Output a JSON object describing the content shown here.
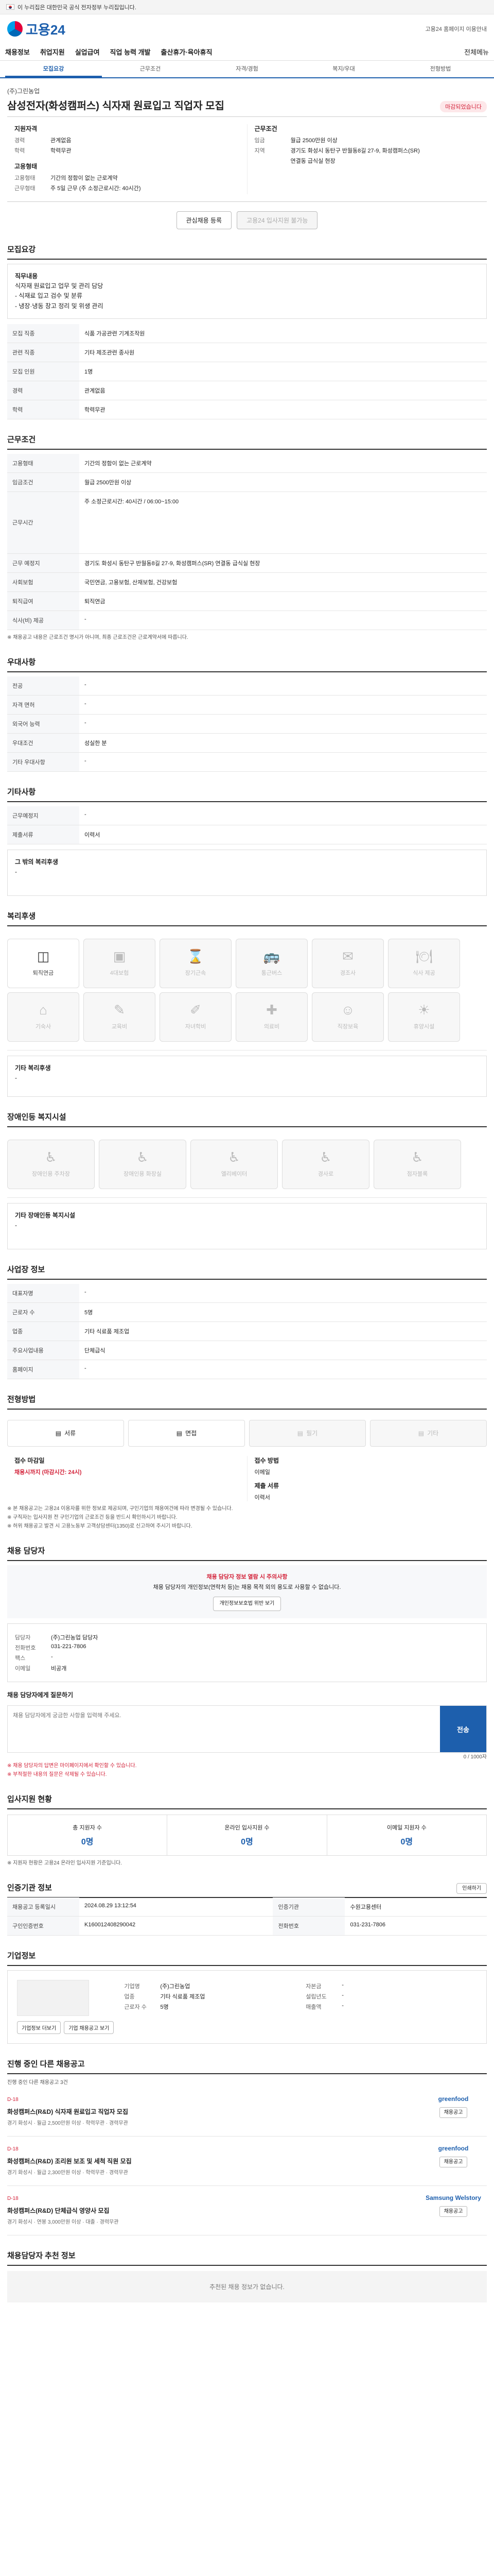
{
  "gov": {
    "text": "이 누리집은 대한민국 공식 전자정부 누리집입니다."
  },
  "header": {
    "logo": "고용24",
    "links": [
      "고용24 홈페이지 이용안내"
    ]
  },
  "gnb": [
    "채용정보",
    "취업지원",
    "실업급여",
    "직업 능력 개발",
    "출산휴가·육아휴직"
  ],
  "gnb_right": "전체메뉴",
  "subtabs": [
    "모집요강",
    "근무조건",
    "자격/경험",
    "복지/우대",
    "전형방법"
  ],
  "job": {
    "company": "(주)그린농업",
    "title": "삼성전자(화성캠퍼스) 식자재 원료입고 직업자 모집",
    "status": "마감되었습니다",
    "summary_left_title": "지원자격",
    "summary_left": [
      [
        "경력",
        "관계없음"
      ],
      [
        "학력",
        "학력무관"
      ]
    ],
    "summary_right_title": "근무조건",
    "summary_right": [
      [
        "임금",
        "월급 2500만원 이상"
      ],
      [
        "지역",
        "경기도 화성시 동탄구 반월동8길 27-9, 화성캠퍼스(SR)"
      ],
      [
        "",
        "연결동 급식실 현장"
      ]
    ],
    "company2_title": "고용형태",
    "company2": [
      [
        "고용형태",
        "기간의 정함이 없는 근로계약"
      ],
      [
        "근무형태",
        "주 5일 근무 (주 소정근로시간: 40시간)"
      ]
    ],
    "btn_scrap": "관심채용 등록",
    "btn_apply": "고용24 입사지원 불가능"
  },
  "sections": {
    "recruit": "모집요강",
    "conditions": "근무조건",
    "preferred": "우대사항",
    "other": "기타사항",
    "welfare": "복리후생",
    "disabled": "장애인등 복지시설",
    "workplace": "사업장 정보",
    "selection": "전형방법",
    "manager": "채용 담당자",
    "applicants": "입사지원 현황",
    "reginfo": "인증기관 정보",
    "company": "기업정보",
    "otherjobs": "진행 중인 다른 채용공고",
    "recommended": "채용담당자 추천 정보"
  },
  "recruit": {
    "duty_title": "직무내용",
    "duty_lines": [
      "식자재 원료입고 업무 및 관리 담당",
      "- 식재료 입고 검수 및 분류",
      "- 냉장·냉동 창고 정리 및 위생 관리"
    ],
    "rows": [
      [
        "모집 직종",
        "식품 가공관련 기계조작원"
      ],
      [
        "관련 직종",
        "기타 제조관련 종사원"
      ],
      [
        "모집 인원",
        "1명"
      ],
      [
        "경력",
        "관계없음"
      ],
      [
        "학력",
        "학력무관"
      ]
    ]
  },
  "conditions": {
    "rows": [
      [
        "고용형태",
        "기간의 정함이 없는 근로계약"
      ],
      [
        "임금조건",
        "월급 2500만원 이상"
      ],
      [
        "근무시간",
        "주 소정근로시간: 40시간 / 06:00~15:00"
      ],
      [
        "근무 예정지",
        "경기도 화성시 동탄구 반월동8길 27-9, 화성캠퍼스(SR) 연결동 급식실 현장"
      ],
      [
        "사회보험",
        "국민연금, 고용보험, 산재보험, 건강보험"
      ],
      [
        "퇴직급여",
        "퇴직연금"
      ],
      [
        "식사(비) 제공",
        "-"
      ]
    ],
    "note": "※ 채용공고 내용은 근로조건 명시가 아니며, 최종 근로조건은 근로계약서에 따릅니다."
  },
  "preferred": {
    "rows": [
      [
        "전공",
        "-"
      ],
      [
        "자격 면허",
        "-"
      ],
      [
        "외국어 능력",
        "-"
      ],
      [
        "우대조건",
        "성실한 분"
      ],
      [
        "기타 우대사항",
        "-"
      ]
    ]
  },
  "other": {
    "rows": [
      [
        "근무예정지",
        "-"
      ],
      [
        "제출서류",
        "이력서"
      ]
    ],
    "note_title": "그 밖의 복리후생",
    "note": "-"
  },
  "welfare": {
    "items": [
      "퇴직연금",
      "4대보험",
      "장기근속",
      "통근버스",
      "경조사",
      "식사 제공",
      "기숙사",
      "교육비",
      "자녀학비",
      "의료비",
      "직장보육",
      "휴양시설"
    ],
    "active": [
      true,
      false,
      false,
      false,
      false,
      false,
      false,
      false,
      false,
      false,
      false,
      false
    ],
    "note_title": "기타 복리후생",
    "note": "-"
  },
  "disabled": {
    "items": [
      "장애인용 주차장",
      "장애인용 화장실",
      "엘리베이터",
      "경사로",
      "점자블록"
    ],
    "note_title": "기타 장애인등 복지시설",
    "note": "-"
  },
  "workplace": {
    "rows": [
      [
        "대표자명",
        "-"
      ],
      [
        "근로자 수",
        "5명"
      ],
      [
        "업종",
        "기타 식료품 제조업"
      ],
      [
        "주요사업내용",
        "단체급식"
      ],
      [
        "홈페이지",
        "-"
      ]
    ]
  },
  "selection": {
    "methods": [
      "서류",
      "면접",
      "필기",
      "기타"
    ],
    "active": [
      true,
      true,
      false,
      false
    ],
    "deadline_label": "접수 마감일",
    "deadline": "채용시까지 (마감시간: 24시)",
    "method_label": "접수 방법",
    "method": "이메일",
    "docs_label": "제출 서류",
    "docs": "이력서",
    "notes": [
      "※ 본 채용공고는 고용24 이용자를 위한 정보로 제공되며, 구인기업의 채용여건에 따라 변경될 수 있습니다.",
      "※ 구직자는 입사지원 전 구인기업의 근로조건 등을 반드시 확인하시기 바랍니다.",
      "※ 허위 채용공고 발견 시 고용노동부 고객상담센터(1350)로 신고하여 주시기 바랍니다."
    ]
  },
  "manager": {
    "alert_title": "채용 담당자 정보 열람 시 주의사항",
    "alert": "채용 담당자의 개인정보(연락처 등)는 채용 목적 외의 용도로 사용할 수 없습니다.",
    "alert_btn": "개인정보보호법 위반 보기",
    "name_label": "담당자",
    "name": "(주)그린농업 담당자",
    "phone_label": "전화번호",
    "phone": "031-221-7806",
    "fax_label": "팩스",
    "fax": "-",
    "email_label": "이메일",
    "email": "비공개",
    "inquiry_title": "채용 담당자에게 질문하기",
    "inquiry_ph": "채용 담당자에게 궁금한 사항을 입력해 주세요.",
    "inquiry_count": "0 / 1000자",
    "send": "전송",
    "footnotes": [
      "※ 채용 담당자의 답변은 마이페이지에서 확인할 수 있습니다.",
      "※ 부적절한 내용의 질문은 삭제될 수 있습니다."
    ]
  },
  "applicants": {
    "items": [
      [
        "총 지원자 수",
        "0명"
      ],
      [
        "온라인 입사지원 수",
        "0명"
      ],
      [
        "이메일 지원자 수",
        "0명"
      ]
    ],
    "note": "※ 지원자 현황은 고용24 온라인 입사지원 기준입니다."
  },
  "reginfo": {
    "rows": [
      [
        "채용공고 등록일시",
        "2024.08.29 13:12:54"
      ],
      [
        "구인인증번호",
        "K160012408290042"
      ],
      [
        "인증기관",
        "수원고용센터"
      ],
      [
        "전화번호",
        "031-231-7806"
      ]
    ],
    "btn": "인쇄하기"
  },
  "company": {
    "rows": [
      [
        "기업명",
        "(주)그린농업"
      ],
      [
        "업종",
        "기타 식료품 제조업"
      ],
      [
        "근로자 수",
        "5명"
      ],
      [
        "자본금",
        "-"
      ],
      [
        "설립년도",
        "-"
      ],
      [
        "매출액",
        "-"
      ]
    ],
    "btns": [
      "기업정보 더보기",
      "기업 채용공고 보기"
    ],
    "link": "기업정보"
  },
  "otherjobs": {
    "note": "진행 중인 다른 채용공고 3건",
    "items": [
      {
        "tag": "D-18",
        "title": "화성캠퍼스(R&D) 식자재 원료입고 직업자 모집",
        "meta": "경기 화성시 · 월급 2,500만원 이상 · 학력무관 · 경력무관",
        "logo": "greenfood",
        "btn": "채용공고"
      },
      {
        "tag": "D-18",
        "title": "화성캠퍼스(R&D) 조리원 보조 및 세척 직원 모집",
        "meta": "경기 화성시 · 월급 2,300만원 이상 · 학력무관 · 경력무관",
        "logo": "greenfood",
        "btn": "채용공고"
      },
      {
        "tag": "D-18",
        "title": "화성캠퍼스(R&D) 단체급식 영양사 모집",
        "meta": "경기 화성시 · 연봉 3,000만원 이상 · 대졸 · 경력무관",
        "logo": "Samsung Welstory",
        "btn": "채용공고"
      }
    ]
  },
  "recommended": {
    "empty": "추천된 채용 정보가 없습니다."
  }
}
